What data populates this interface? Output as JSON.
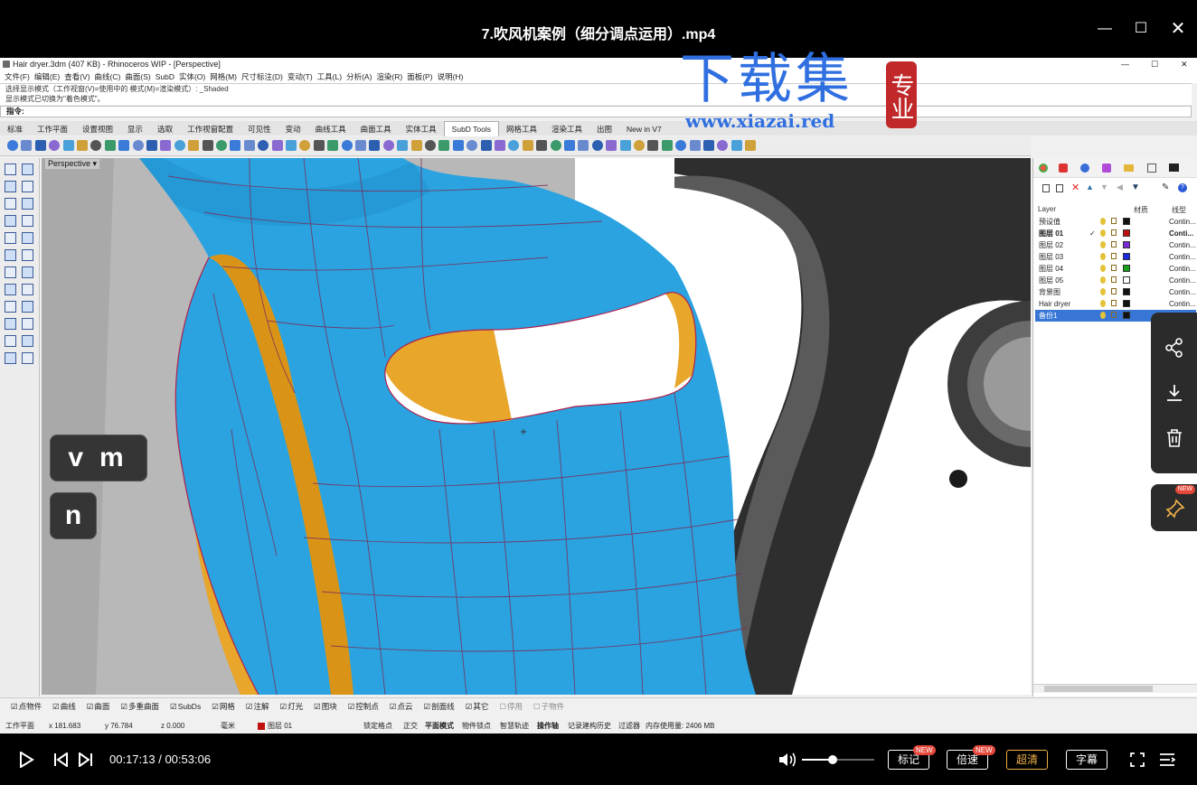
{
  "player": {
    "title": "7.吹风机案例（细分调点运用）.mp4",
    "time_current": "00:17:13",
    "time_separator": " / ",
    "time_total": "00:53:06",
    "btn_mark": "标记",
    "btn_speed": "倍速",
    "btn_quality": "超清",
    "btn_subtitle": "字幕",
    "badge_new": "NEW",
    "volume_level": 0.42
  },
  "watermark": {
    "main": "下载集",
    "seal": "专业",
    "url": "www.xiazai.red"
  },
  "rhino": {
    "window_title": "Hair dryer.3dm (407 KB) - Rhinoceros WIP - [Perspective]",
    "menu": [
      "文件(F)",
      "编辑(E)",
      "查看(V)",
      "曲线(C)",
      "曲面(S)",
      "SubD",
      "实体(O)",
      "网格(M)",
      "尺寸标注(D)",
      "变动(T)",
      "工具(L)",
      "分析(A)",
      "渲染(R)",
      "面板(P)",
      "说明(H)"
    ],
    "cmd_history_1": "选择显示模式（工作视窗(V)=使用中的  模式(M)=渲染模式）: _Shaded",
    "cmd_history_2": "显示模式已切换为\"着色模式\"。",
    "cmd_prompt": "指令:",
    "tabs": [
      "标准",
      "工作平面",
      "设置视图",
      "显示",
      "选取",
      "工作视窗配置",
      "可见性",
      "变动",
      "曲线工具",
      "曲面工具",
      "实体工具",
      "SubD Tools",
      "网格工具",
      "渲染工具",
      "出图",
      "New in V7"
    ],
    "active_tab": "SubD Tools",
    "viewport_label": "Perspective",
    "keys": [
      "v",
      "m",
      "n"
    ]
  },
  "layers": {
    "col_layer": "Layer",
    "col_material": "材质",
    "col_linetype": "线型",
    "items": [
      {
        "name": "预设值",
        "color": "#111111",
        "linetype": "Contin..."
      },
      {
        "name": "图层 01",
        "color": "#c01010",
        "linetype": "Conti...",
        "current": "✓"
      },
      {
        "name": "图层 02",
        "color": "#7a2ad6",
        "linetype": "Contin..."
      },
      {
        "name": "图层 03",
        "color": "#1a2ae0",
        "linetype": "Contin..."
      },
      {
        "name": "图层 04",
        "color": "#16a016",
        "linetype": "Contin..."
      },
      {
        "name": "图层 05",
        "color": "#ffffff",
        "linetype": "Contin..."
      },
      {
        "name": "背景图",
        "color": "#111111",
        "linetype": "Contin..."
      },
      {
        "name": "Hair dryer",
        "color": "#111111",
        "linetype": "Contin..."
      },
      {
        "name": "备份1",
        "color": "#111111",
        "linetype": "Contin...",
        "selected": true
      }
    ]
  },
  "osnap": [
    "点物件",
    "曲线",
    "曲面",
    "多重曲面",
    "SubDs",
    "网格",
    "注解",
    "灯光",
    "图块",
    "控制点",
    "点云",
    "剖面线",
    "其它",
    "停用",
    "子物件"
  ],
  "status": {
    "cplane": "工作平面",
    "x": "x 181.683",
    "y": "y 76.784",
    "z": "z 0.000",
    "unit": "毫米",
    "layer": "图层 01",
    "snap": "锁定格点",
    "ortho": "正交",
    "planar": "平面模式",
    "osnap": "物件锁点",
    "smarttrack": "智慧轨迹",
    "gumball": "操作轴",
    "history": "记录建构历史",
    "filter": "过滤器",
    "memory": "内存使用量: 2406 MB"
  }
}
